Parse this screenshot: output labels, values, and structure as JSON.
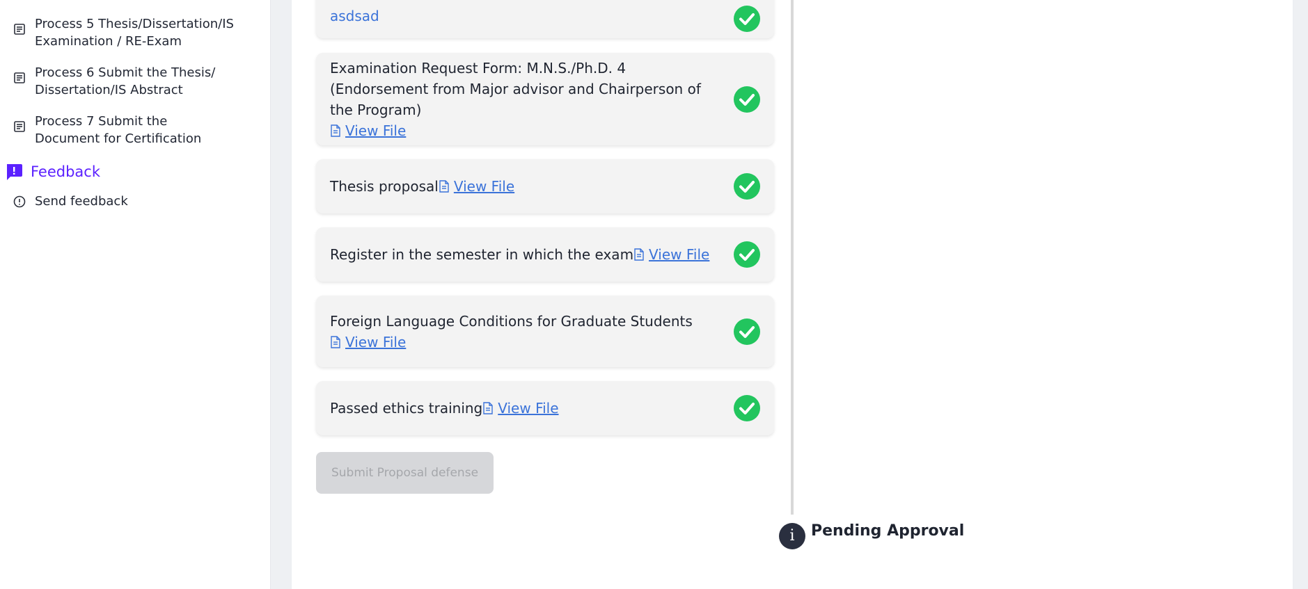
{
  "sidebar": {
    "process_items": [
      {
        "label": "Process 5 Thesis/Dissertation/IS\nExamination / RE-Exam"
      },
      {
        "label": "Process 6 Submit the Thesis/\nDissertation/IS Abstract"
      },
      {
        "label": "Process 7 Submit the\nDocument for Certification"
      }
    ],
    "feedback": {
      "label": "Feedback",
      "send_label": "Send feedback"
    }
  },
  "main": {
    "top_link": "asdsad",
    "requirements": [
      {
        "text": "Examination Request Form: M.N.S./Ph.D. 4 (Endorsement from Major advisor and Chairperson of the Program)",
        "link": "View File"
      },
      {
        "text": "Thesis proposal",
        "link": "View File"
      },
      {
        "text": "Register in the semester in which the exam",
        "link": "View File"
      },
      {
        "text": "Foreign Language Conditions for Graduate Students",
        "link": "View File"
      },
      {
        "text": "Passed ethics training",
        "link": "View File"
      }
    ],
    "submit_label": "Submit Proposal defense",
    "status": {
      "icon_glyph": "i",
      "label": "Pending Approval"
    }
  },
  "colors": {
    "accent": "#5b21ff",
    "link": "#3b73d9",
    "success": "#22c55e",
    "status_dot": "#2a2f3f"
  }
}
